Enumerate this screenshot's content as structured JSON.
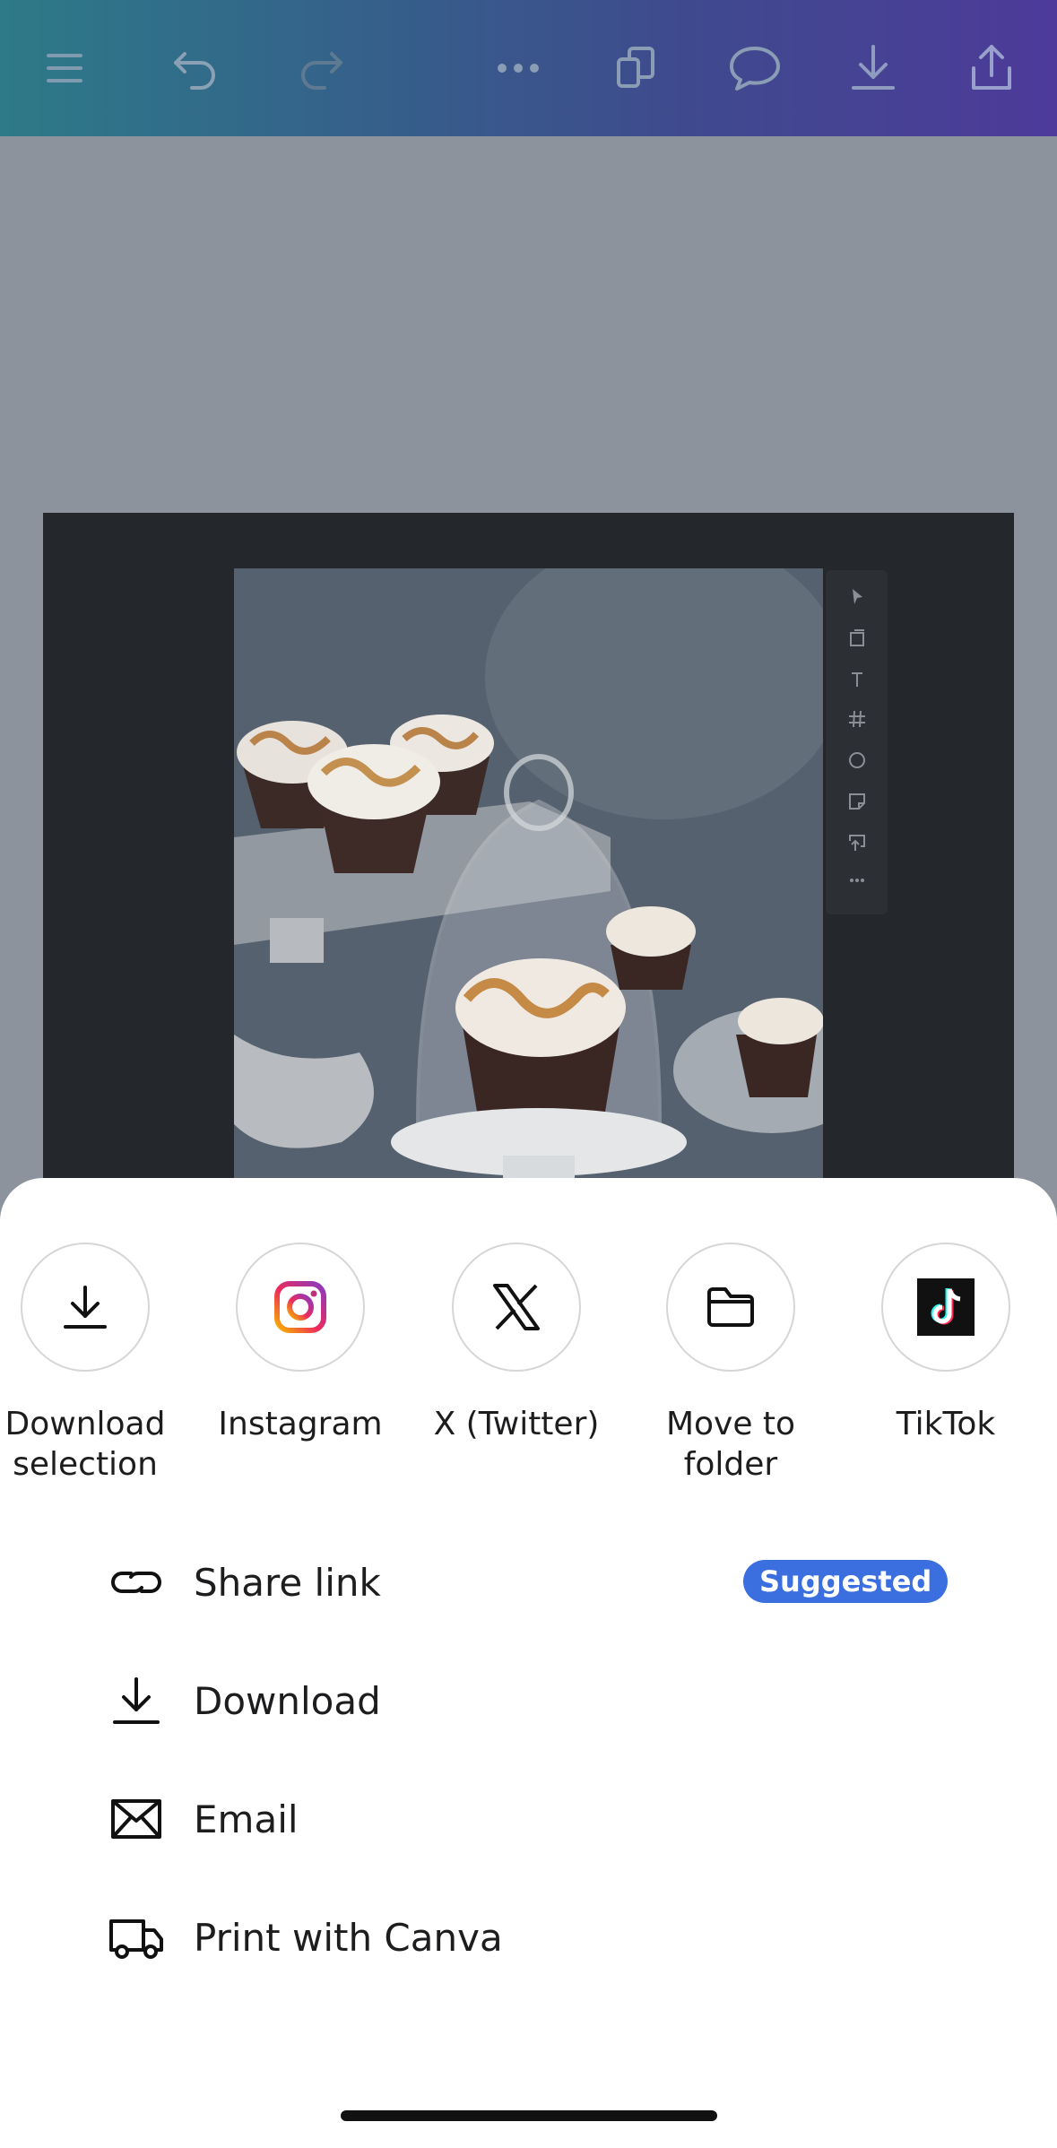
{
  "toolbar": {
    "icons": [
      "menu-icon",
      "undo-icon",
      "redo-icon",
      "more-icon",
      "pages-icon",
      "comment-icon",
      "download-icon",
      "share-icon"
    ],
    "gradient": [
      "#2d7a88",
      "#4d3a9a"
    ]
  },
  "canvas": {
    "page_color": "#24282d",
    "side_tools": [
      "pointer-icon",
      "frame-icon",
      "text-icon",
      "grid-icon",
      "circle-icon",
      "sticky-icon",
      "upload-icon",
      "more-icon"
    ]
  },
  "share_sheet": {
    "apps": [
      {
        "label": "Download selection",
        "icon": "download-icon"
      },
      {
        "label": "Instagram",
        "icon": "instagram-icon"
      },
      {
        "label": "X (Twitter)",
        "icon": "x-twitter-icon"
      },
      {
        "label": "Move to folder",
        "icon": "folder-icon"
      },
      {
        "label": "TikTok",
        "icon": "tiktok-icon"
      }
    ],
    "options": [
      {
        "label": "Share link",
        "icon": "link-icon",
        "badge": "Suggested"
      },
      {
        "label": "Download",
        "icon": "download-icon"
      },
      {
        "label": "Email",
        "icon": "email-icon"
      },
      {
        "label": "Print with Canva",
        "icon": "truck-icon"
      }
    ],
    "badge_color": "#3b6fe0"
  }
}
